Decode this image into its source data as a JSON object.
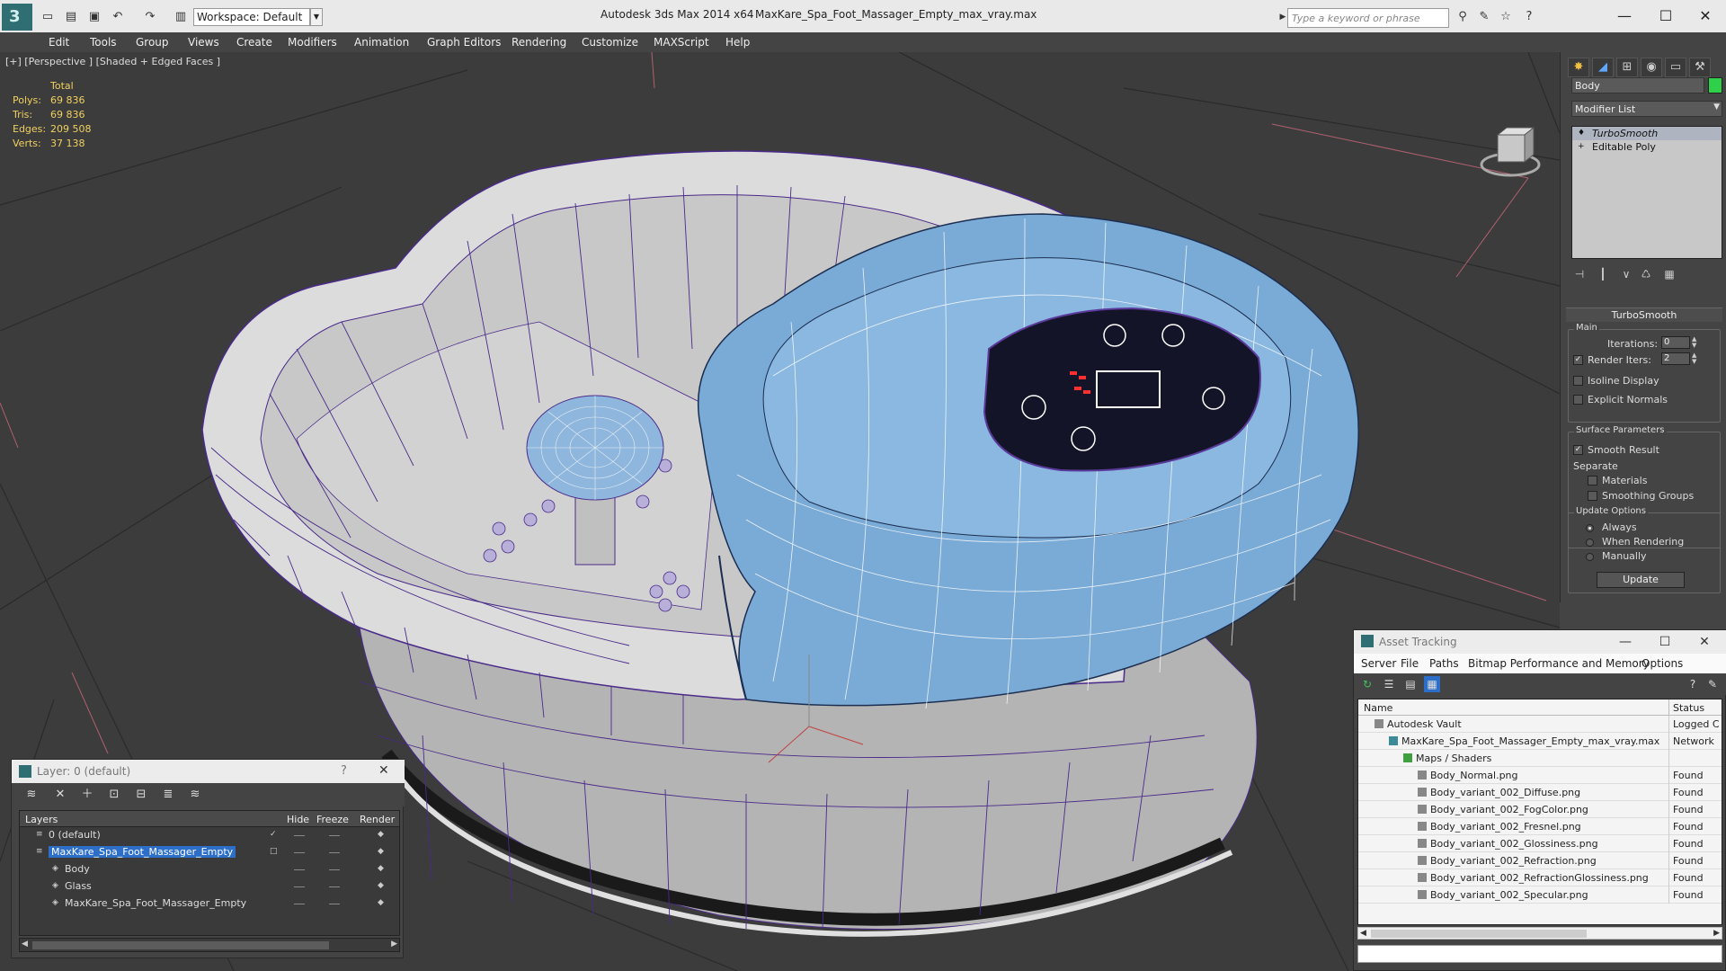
{
  "title_bar": {
    "app_title": "Autodesk 3ds Max  2014 x64",
    "file_title": "MaxKare_Spa_Foot_Massager_Empty_max_vray.max",
    "workspace": "Workspace: Default",
    "search_placeholder": "Type a keyword or phrase"
  },
  "menu": [
    "Edit",
    "Tools",
    "Group",
    "Views",
    "Create",
    "Modifiers",
    "Animation",
    "Graph Editors",
    "Rendering",
    "Customize",
    "MAXScript",
    "Help"
  ],
  "viewport": {
    "label": "[+] [Perspective ] [Shaded + Edged Faces ]",
    "stats": {
      "total_label": "Total",
      "rows": [
        {
          "label": "Polys:",
          "value": "69 836"
        },
        {
          "label": "Tris:",
          "value": "69 836"
        },
        {
          "label": "Edges:",
          "value": "209 508"
        },
        {
          "label": "Verts:",
          "value": "37 138"
        }
      ]
    }
  },
  "command_panel": {
    "object_name": "Body",
    "object_color": "#2fd04a",
    "modifier_list": "Modifier List",
    "stack": [
      "TurboSmooth",
      "Editable Poly"
    ],
    "rollout": "TurboSmooth",
    "main_label": "Main",
    "iterations_label": "Iterations:",
    "iterations_value": "0",
    "render_iters_label": "Render Iters:",
    "render_iters_value": "2",
    "render_iters_checked": true,
    "isoline_label": "Isoline Display",
    "explicit_normals_label": "Explicit Normals",
    "surface_params_label": "Surface Parameters",
    "smooth_result_label": "Smooth Result",
    "smooth_result_checked": true,
    "separate_label": "Separate",
    "materials_label": "Materials",
    "smoothing_groups_label": "Smoothing Groups",
    "update_options_label": "Update Options",
    "always_label": "Always",
    "when_rendering_label": "When Rendering",
    "manually_label": "Manually",
    "update_button": "Update"
  },
  "asset_tracking": {
    "title": "Asset Tracking",
    "menu": [
      "Server",
      "File",
      "Paths",
      "Bitmap Performance and Memory",
      "Options"
    ],
    "columns": {
      "name": "Name",
      "status": "Status"
    },
    "rows": [
      {
        "name": "Autodesk Vault",
        "status": "Logged C",
        "indent": 0
      },
      {
        "name": "MaxKare_Spa_Foot_Massager_Empty_max_vray.max",
        "status": "Network",
        "indent": 1
      },
      {
        "name": "Maps / Shaders",
        "status": "",
        "indent": 2
      },
      {
        "name": "Body_Normal.png",
        "status": "Found",
        "indent": 3
      },
      {
        "name": "Body_variant_002_Diffuse.png",
        "status": "Found",
        "indent": 3
      },
      {
        "name": "Body_variant_002_FogColor.png",
        "status": "Found",
        "indent": 3
      },
      {
        "name": "Body_variant_002_Fresnel.png",
        "status": "Found",
        "indent": 3
      },
      {
        "name": "Body_variant_002_Glossiness.png",
        "status": "Found",
        "indent": 3
      },
      {
        "name": "Body_variant_002_Refraction.png",
        "status": "Found",
        "indent": 3
      },
      {
        "name": "Body_variant_002_RefractionGlossiness.png",
        "status": "Found",
        "indent": 3
      },
      {
        "name": "Body_variant_002_Specular.png",
        "status": "Found",
        "indent": 3
      }
    ]
  },
  "layers": {
    "title": "Layer: 0 (default)",
    "help": "?",
    "columns": {
      "layers": "Layers",
      "hide": "Hide",
      "freeze": "Freeze",
      "render": "Render"
    },
    "rows": [
      {
        "name": "0 (default)",
        "indent": 0,
        "selected": false
      },
      {
        "name": "MaxKare_Spa_Foot_Massager_Empty",
        "indent": 0,
        "selected": true
      },
      {
        "name": "Body",
        "indent": 1,
        "selected": false
      },
      {
        "name": "Glass",
        "indent": 1,
        "selected": false
      },
      {
        "name": "MaxKare_Spa_Foot_Massager_Empty",
        "indent": 1,
        "selected": false
      }
    ]
  },
  "colors": {
    "model_blue": "#7aaad6",
    "wire_purple": "#4a2a8a",
    "selection_blue": "#2d6fc8"
  }
}
